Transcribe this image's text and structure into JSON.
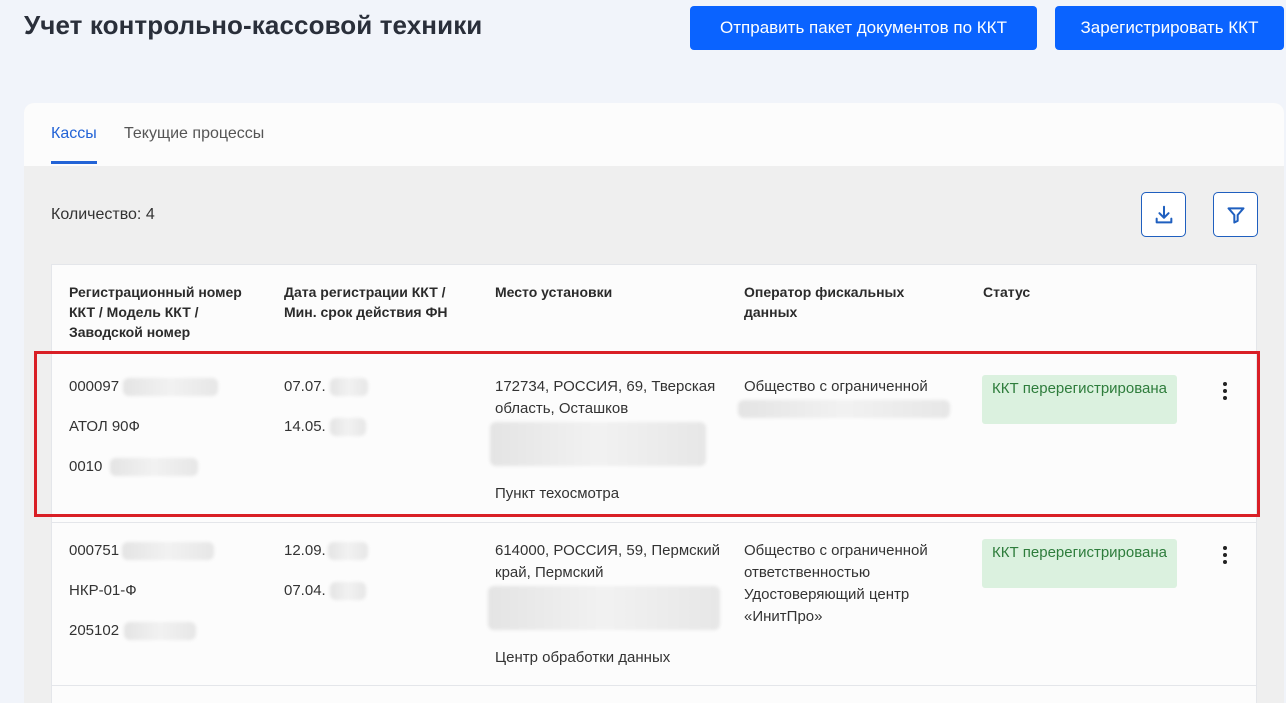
{
  "header": {
    "title": "Учет контрольно-кассовой техники",
    "send_button": "Отправить пакет документов по ККТ",
    "register_button": "Зарегистрировать ККТ"
  },
  "tabs": [
    {
      "label": "Кассы",
      "active": true
    },
    {
      "label": "Текущие процессы",
      "active": false
    }
  ],
  "count_label": "Количество: 4",
  "toolbar": {
    "download_icon": "download-icon",
    "filter_icon": "filter-icon"
  },
  "columns": [
    "Регистрационный номер ККТ / Модель ККТ / Заводской номер",
    "Дата регистрации ККТ / Мин. срок действия ФН",
    "Место установки",
    "Оператор фискальных данных",
    "Статус"
  ],
  "rows": [
    {
      "reg_number": "000097",
      "model": "АТОЛ 90Ф",
      "serial": "0010",
      "reg_date": "07.07.",
      "fn_date": "14.05.",
      "address": "172734, РОССИЯ, 69, Тверская область, Осташков",
      "place_name": "Пункт техосмотра",
      "operator": "Общество с ограниченной",
      "status": "ККТ перерегистрирована",
      "highlighted": true
    },
    {
      "reg_number": "000751",
      "model": "НКР-01-Ф",
      "serial": "205102",
      "reg_date": "12.09.",
      "fn_date": "07.04.",
      "address": "614000, РОССИЯ, 59, Пермский край, Пермский",
      "place_name": "Центр обработки данных",
      "operator": "Общество с ограниченной ответственностью Удостоверяющий центр «ИнитПро»",
      "status": "ККТ перерегистрирована",
      "highlighted": false
    }
  ],
  "colors": {
    "primary": "#0a63ff",
    "status_bg": "#dbf1df",
    "status_text": "#2e7d3c",
    "highlight": "#d91f26"
  }
}
